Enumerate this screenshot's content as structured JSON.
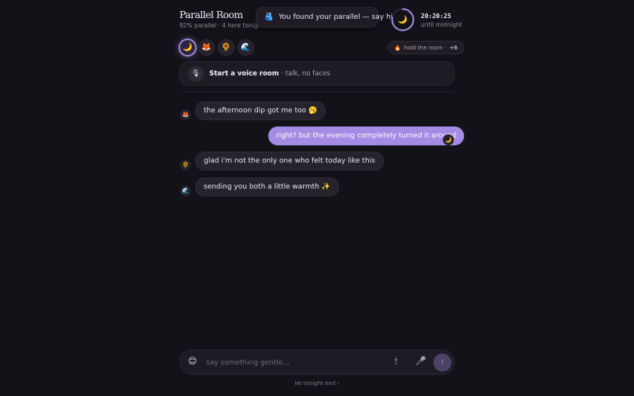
{
  "header": {
    "title": "Parallel Room",
    "subtitle": "92% parallel · 4 here tonight",
    "toast": {
      "icon": "🫂",
      "text": "You found your parallel — say hi"
    },
    "timer": {
      "icon": "🌙",
      "time": "20:20:25",
      "caption": "until midnight",
      "progress": 0.78,
      "accent": "#a58be4"
    }
  },
  "avatars": [
    {
      "icon": "🌙",
      "name": "moon-avatar",
      "active": true
    },
    {
      "icon": "🦊",
      "name": "fox-avatar",
      "active": false
    },
    {
      "icon": "🌻",
      "name": "sunflower-avatar",
      "active": false
    },
    {
      "icon": "🌊",
      "name": "wave-avatar",
      "active": false
    }
  ],
  "hold": {
    "icon": "🔥",
    "label": "hold the room ·",
    "count": "+6"
  },
  "voice": {
    "icon": "🎙",
    "title": "Start a voice room",
    "rest": " · talk, no faces"
  },
  "messages": [
    {
      "from": "fox",
      "avatar": "🦊",
      "text": "the afternoon dip got me too 🥱",
      "mine": false
    },
    {
      "from": "me",
      "avatar": "🌙",
      "text": "right? but the evening completely turned it around",
      "mine": true
    },
    {
      "from": "sunflower",
      "avatar": "🌻",
      "text": "glad i'm not the only one who felt today like this",
      "mine": false
    },
    {
      "from": "wave",
      "avatar": "🌊",
      "text": "sending you both a little warmth ✨",
      "mine": false
    }
  ],
  "composer": {
    "emoji_icon": "😊",
    "placeholder": "say something gentle...",
    "value": "",
    "candle_icon": "🕯",
    "mic_icon": "🎤",
    "send_icon": "↑"
  },
  "footer": {
    "end_link": "let tonight end ›"
  }
}
